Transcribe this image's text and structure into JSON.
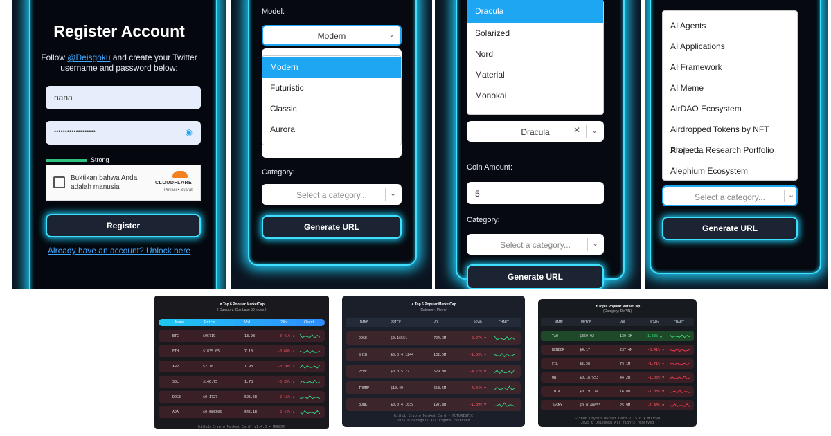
{
  "register": {
    "title": "Register Account",
    "intro_prefix": "Follow ",
    "intro_link": "@Deisgoku",
    "intro_suffix": " and create your Twitter username and password below:",
    "username_value": "nana",
    "password_value": "•••••••••••••••••••",
    "strength": "Strong",
    "captcha_text": "Buktikan bahwa Anda adalah manusia",
    "captcha_brand": "CLOUDFLARE",
    "captcha_small": "Privasi • Syarat",
    "register_label": "Register",
    "unlock_link": "Already have an account? Unlock here"
  },
  "model_panel": {
    "model_label": "Model:",
    "model_value": "Modern",
    "options": [
      "Modern",
      "Futuristic",
      "Classic",
      "Aurora"
    ],
    "category_label": "Category:",
    "category_placeholder": "Select a category...",
    "generate_label": "Generate URL"
  },
  "theme_panel": {
    "options": [
      "Dracula",
      "Solarized",
      "Nord",
      "Material",
      "Monokai"
    ],
    "theme_value": "Dracula",
    "coin_label": "Coin Amount:",
    "coin_value": "5",
    "category_label": "Category:",
    "category_placeholder": "Select a category...",
    "generate_label": "Generate URL"
  },
  "category_panel": {
    "options": [
      "AI Agents",
      "AI Applications",
      "AI Framework",
      "AI Meme",
      "AirDAO Ecosystem",
      "Airdropped Tokens by NFT Projects",
      "Alameda Research Portfolio",
      "Alephium Ecosystem"
    ],
    "category_placeholder": "Select a category...",
    "generate_label": "Generate URL"
  },
  "card1": {
    "title": "↗ Top 6 Popular MarketCap",
    "subtitle": "( Category: Coinbase 50 Index )",
    "headers": [
      "Name",
      "Price",
      "Vol",
      "24h",
      "Chart"
    ],
    "rows": [
      {
        "name": "BTC",
        "price": "$95719",
        "vol": "13.9B",
        "change": "-0.41% ↓"
      },
      {
        "name": "ETH",
        "price": "$1835.05",
        "vol": "7.1B",
        "change": "-0.68% ↓"
      },
      {
        "name": "XRP",
        "price": "$2.18",
        "vol": "1.9B",
        "change": "-0.20% ↓"
      },
      {
        "name": "SOL",
        "price": "$146.75",
        "vol": "1.7B",
        "change": "-0.35% ↓"
      },
      {
        "name": "DOGE",
        "price": "$0.1727",
        "vol": "595.5B",
        "change": "-2.16% ↓"
      },
      {
        "name": "ADA",
        "price": "$0.686306",
        "vol": "645.1B",
        "change": "-2.44% ↓"
      }
    ],
    "footer": "Github Crypto Market Card* v1.4.0 • MODERN",
    "colors": {
      "bg": "#1a1a1e",
      "row": "#3a2026",
      "header": "#1ec8f0"
    }
  },
  "card2": {
    "title": "↗ Top 5 Popular MarketCap",
    "subtitle": "(Category: Meme)",
    "headers": [
      "NAME",
      "PRICE",
      "VOL",
      "%24h",
      "CHART"
    ],
    "rows": [
      {
        "name": "DOGE",
        "price": "$0.16561",
        "vol": "724.3M",
        "change": "-2.97% ▼"
      },
      {
        "name": "SHIB",
        "price": "$0.0(4)1244",
        "vol": "132.5M",
        "change": "-1.69% ▼"
      },
      {
        "name": "PEPE",
        "price": "$0.0(5)77",
        "vol": "529.9M",
        "change": "-4.22% ▼"
      },
      {
        "name": "TRUMP",
        "price": "$10.49",
        "vol": "658.5M",
        "change": "-4.04% ▼"
      },
      {
        "name": "BONK",
        "price": "$0.0(4)1639",
        "vol": "197.8M",
        "change": "-1.89% ▼"
      }
    ],
    "footer1": "Github Crypto Market Card • FUTURISTIC",
    "footer2": "2025 © Deisgoku All rights reserved",
    "colors": {
      "bg": "#1b1f2a",
      "row": "#3d252c"
    }
  },
  "card3": {
    "title": "↗ Top 6 Popular MarketCap",
    "subtitle": "(Category: DePIN)",
    "headers": [
      "NAME",
      "PRICE",
      "VOL",
      "%24h",
      "CHART"
    ],
    "rows": [
      {
        "name": "TAO",
        "price": "$359.92",
        "vol": "130.3M",
        "change": "1.53% ▲"
      },
      {
        "name": "RENDER",
        "price": "$4.17",
        "vol": "237.4M",
        "change": "-3.41% ▼"
      },
      {
        "name": "FIL",
        "price": "$2.58",
        "vol": "79.1M",
        "change": "-1.71% ▼"
      },
      {
        "name": "ONT",
        "price": "$0.187553",
        "vol": "44.2M",
        "change": "-1.03% ▼"
      },
      {
        "name": "IOTA",
        "price": "$0.191114",
        "vol": "16.8M",
        "change": "-1.03% ▼"
      },
      {
        "name": "JASMY",
        "price": "$0.0140053",
        "vol": "25.9M",
        "change": "-1.43% ▼"
      }
    ],
    "footer1": "Github Crypto Market Card v1.5.0 • MODERN",
    "footer2": "2025 © Deisgoku All rights reserved",
    "colors": {
      "bg": "#171a1f",
      "row": "#3a2024",
      "up": "#1e4a2a"
    }
  }
}
